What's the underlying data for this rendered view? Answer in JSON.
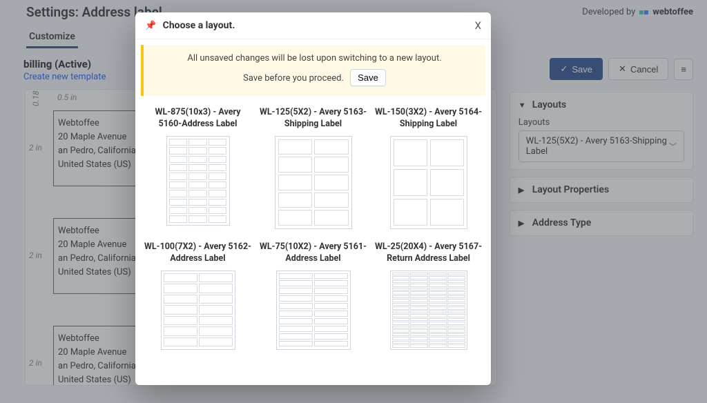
{
  "header": {
    "title": "Settings: Address label",
    "developed_by": "Developed by",
    "brand": "webtoffee"
  },
  "tabs": {
    "customize": "Customize"
  },
  "template": {
    "name": "billing (Active)",
    "create_link": "Create new template"
  },
  "toolbar": {
    "save": "Save",
    "cancel": "Cancel"
  },
  "canvas": {
    "top_margin": "0.5 in",
    "left_margin": "0.18 in",
    "row_height": "2 in",
    "address": {
      "name": "Webtoffee",
      "line1": "20 Maple Avenue",
      "line2": "an Pedro, California",
      "line3": "United States (US)"
    }
  },
  "sidebar": {
    "layouts_header": "Layouts",
    "layouts_field": "Layouts",
    "layouts_selected": "WL-125(5X2) - Avery 5163-Shipping Label",
    "layout_properties": "Layout Properties",
    "address_type": "Address Type"
  },
  "modal": {
    "title": "Choose a layout.",
    "warning_line1": "All unsaved changes will be lost upon switching to a new layout.",
    "warning_line2": "Save before you proceed.",
    "save": "Save",
    "layouts": [
      {
        "title": "WL-875(10x3) - Avery 5160-Address Label",
        "preset": "grid-10x3",
        "cells": 30
      },
      {
        "title": "WL-125(5X2) - Avery 5163-Shipping Label",
        "preset": "grid-5x2",
        "cells": 10
      },
      {
        "title": "WL-150(3X2) - Avery 5164-Shipping Label",
        "preset": "grid-3x2",
        "cells": 6
      },
      {
        "title": "WL-100(7X2) - Avery 5162-Address Label",
        "preset": "grid-7x2",
        "cells": 14
      },
      {
        "title": "WL-75(10X2) - Avery 5161-Address Label",
        "preset": "grid-10x2",
        "cells": 20
      },
      {
        "title": "WL-25(20X4) - Avery 5167-Return Address Label",
        "preset": "grid-20x4",
        "cells": 80
      }
    ]
  }
}
